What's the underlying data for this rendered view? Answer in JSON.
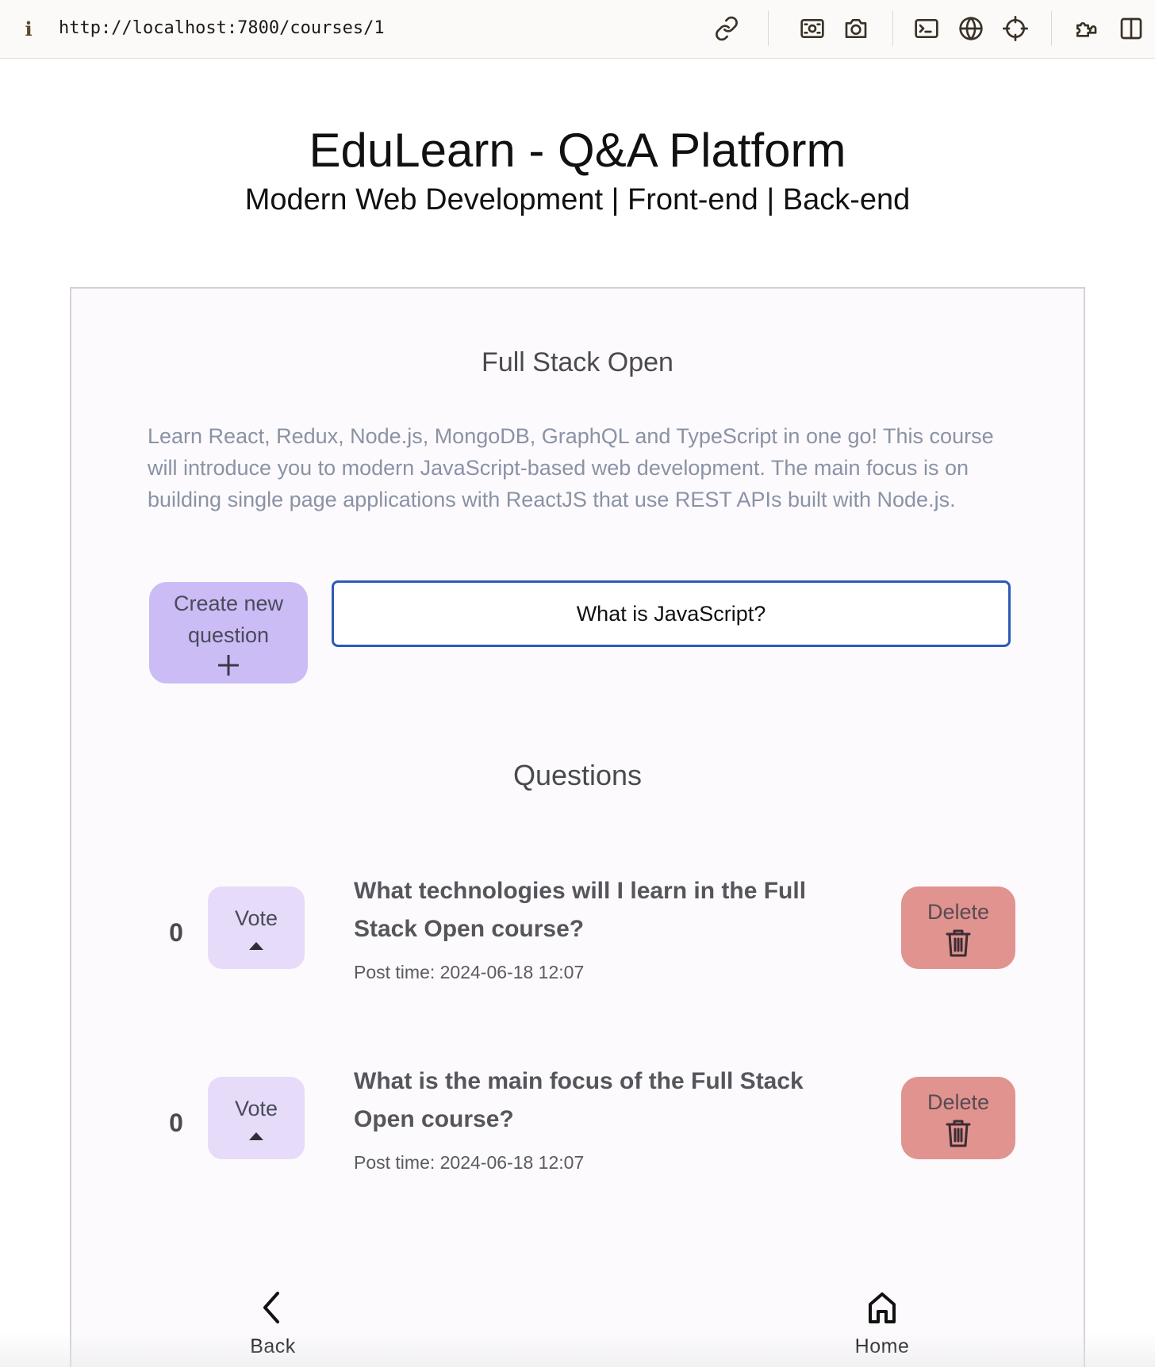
{
  "browser": {
    "url": "http://localhost:7800/courses/1",
    "icons": [
      "info-icon",
      "link-icon",
      "image-icon",
      "camera-icon",
      "terminal-icon",
      "globe-icon",
      "crosshair-icon",
      "extensions-icon",
      "sidebar-icon"
    ]
  },
  "header": {
    "title": "EduLearn - Q&A Platform",
    "subtitle": "Modern Web Development | Front-end | Back-end"
  },
  "course": {
    "name": "Full Stack Open",
    "description": "Learn React, Redux, Node.js, MongoDB, GraphQL and TypeScript in one go! This course will introduce you to modern JavaScript-based web development. The main focus is on building single page applications with ReactJS that use REST APIs built with Node.js."
  },
  "create": {
    "button_label": "Create new question",
    "input_value": "What is JavaScript?"
  },
  "questions": {
    "heading": "Questions",
    "items": [
      {
        "votes": "0",
        "vote_label": "Vote",
        "title": "What technologies will I learn in the Full Stack Open course?",
        "post_time": "Post time: 2024-06-18 12:07",
        "delete_label": "Delete"
      },
      {
        "votes": "0",
        "vote_label": "Vote",
        "title": "What is the main focus of the Full Stack Open course?",
        "post_time": "Post time: 2024-06-18 12:07",
        "delete_label": "Delete"
      }
    ]
  },
  "nav": {
    "back_label": "Back",
    "home_label": "Home"
  },
  "colors": {
    "create_button": "#cbbcf6",
    "vote_button": "#e6dcfa",
    "delete_button": "#e0938f",
    "input_border": "#2d5ab8",
    "description_text": "#8a92a6"
  }
}
